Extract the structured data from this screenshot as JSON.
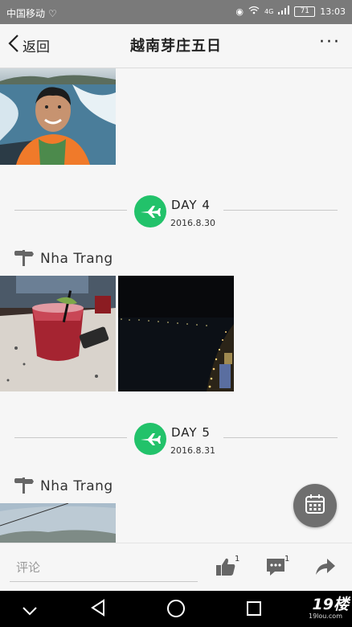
{
  "status_bar": {
    "carrier": "中国移动",
    "network": "4G",
    "battery": "71",
    "time": "13:03"
  },
  "header": {
    "back_label": "返回",
    "title": "越南芽庄五日",
    "more_label": "···"
  },
  "days": [
    {
      "day_label": "DAY 4",
      "date": "2016.8.30",
      "location": "Nha Trang"
    },
    {
      "day_label": "DAY 5",
      "date": "2016.8.31",
      "location": "Nha Trang"
    }
  ],
  "comment_bar": {
    "placeholder": "评论",
    "like_count": "1",
    "comment_count": "1"
  },
  "watermark": {
    "main": "19楼",
    "sub": "19lou.com"
  },
  "colors": {
    "day_circle": "#22c26a",
    "fab": "#6f6f6f",
    "status_bar": "#7a7a7a"
  },
  "icons": [
    "back-chevron-icon",
    "more-icon",
    "airplane-icon",
    "signpost-icon",
    "calendar-icon",
    "thumbs-up-icon",
    "comment-icon",
    "share-icon",
    "nav-down-icon",
    "nav-back-icon",
    "nav-home-icon",
    "nav-recent-icon"
  ]
}
